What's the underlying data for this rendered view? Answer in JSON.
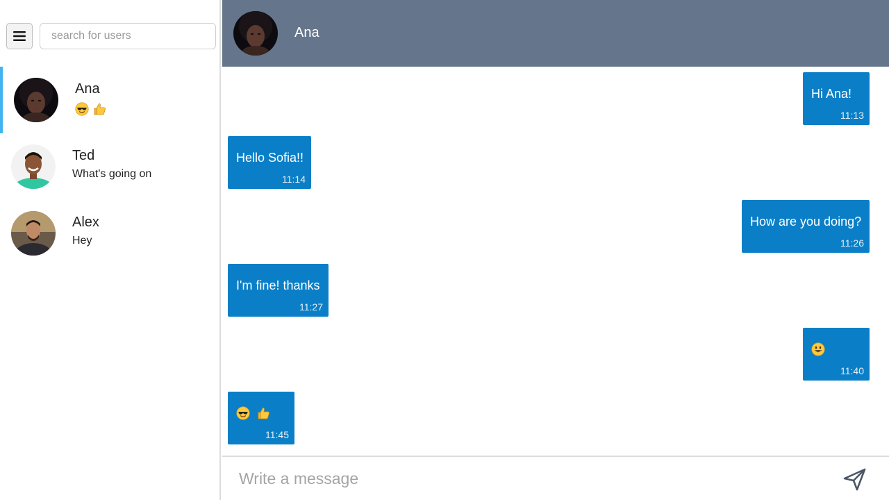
{
  "sidebar": {
    "menu_icon": "hamburger-icon",
    "search": {
      "placeholder": "search for users",
      "value": ""
    },
    "contacts": [
      {
        "name": "Ana",
        "last_message": "",
        "last_message_emojis": [
          "sunglasses-emoji",
          "thumbs-up-emoji"
        ],
        "active": true
      },
      {
        "name": "Ted",
        "last_message": "What's going on",
        "active": false
      },
      {
        "name": "Alex",
        "last_message": "Hey",
        "active": false
      }
    ]
  },
  "chat": {
    "header_name": "Ana",
    "messages": [
      {
        "text": "Hi Ana!",
        "time": "11:13",
        "side": "right"
      },
      {
        "text": "Hello Sofia!!",
        "time": "11:14",
        "side": "left"
      },
      {
        "text": "How are you doing?",
        "time": "11:26",
        "side": "right"
      },
      {
        "text": "I'm fine! thanks",
        "time": "11:27",
        "side": "left"
      },
      {
        "text": "",
        "emojis": [
          "grinning-emoji"
        ],
        "time": "11:40",
        "side": "right"
      },
      {
        "text": "",
        "emojis": [
          "sunglasses-emoji",
          "thumbs-up-emoji"
        ],
        "time": "11:45",
        "side": "left"
      }
    ]
  },
  "composer": {
    "placeholder": "Write a message",
    "value": "",
    "send_icon": "send-icon"
  },
  "colors": {
    "header_bg": "#65758b",
    "bubble_bg": "#0a7fc7",
    "active_indicator": "#43b2f0",
    "emoji_yellow": "#ffc83d"
  }
}
